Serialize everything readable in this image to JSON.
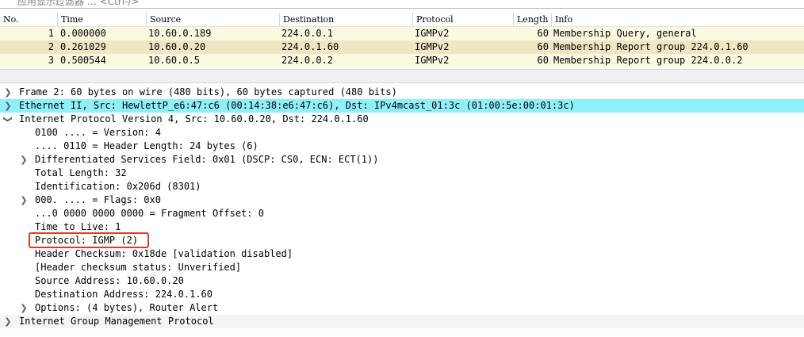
{
  "filter_bar": {
    "placeholder": "应用显示过滤器 … <Ctrl-/>"
  },
  "packet_list": {
    "columns": [
      "No.",
      "Time",
      "Source",
      "Destination",
      "Protocol",
      "Length",
      "Info"
    ],
    "rows": [
      {
        "no": "1",
        "time": "0.000000",
        "source": "10.60.0.189",
        "destination": "224.0.0.1",
        "protocol": "IGMPv2",
        "length": "60",
        "info": "Membership Query, general"
      },
      {
        "no": "2",
        "time": "0.261029",
        "source": "10.60.0.20",
        "destination": "224.0.1.60",
        "protocol": "IGMPv2",
        "length": "60",
        "info": "Membership Report group 224.0.1.60"
      },
      {
        "no": "3",
        "time": "0.500544",
        "source": "10.60.0.5",
        "destination": "224.0.0.2",
        "protocol": "IGMPv2",
        "length": "60",
        "info": "Membership Report group 224.0.0.2"
      }
    ]
  },
  "details": {
    "frame": "Frame 2: 60 bytes on wire (480 bits), 60 bytes captured (480 bits)",
    "ethernet": "Ethernet II, Src: HewlettP_e6:47:c6 (00:14:38:e6:47:c6), Dst: IPv4mcast_01:3c (01:00:5e:00:01:3c)",
    "ipv4": "Internet Protocol Version 4, Src: 10.60.0.20, Dst: 224.0.1.60",
    "ip_fields": [
      "0100 .... = Version: 4",
      ".... 0110 = Header Length: 24 bytes (6)",
      "Differentiated Services Field: 0x01 (DSCP: CS0, ECN: ECT(1))",
      "Total Length: 32",
      "Identification: 0x206d (8301)",
      "000. .... = Flags: 0x0",
      "...0 0000 0000 0000 = Fragment Offset: 0",
      "Time to Live: 1",
      "Protocol: IGMP (2)",
      "Header Checksum: 0x18de [validation disabled]",
      "[Header checksum status: Unverified]",
      "Source Address: 10.60.0.20",
      "Destination Address: 224.0.1.60",
      "Options: (4 bytes), Router Alert"
    ],
    "igmp": "Internet Group Management Protocol"
  },
  "colors": {
    "row_odd": "#fafae0",
    "row_selected": "#f0e6c4",
    "ethernet_highlight": "#8ff0fa",
    "annotation_box": "#e03a2c"
  }
}
